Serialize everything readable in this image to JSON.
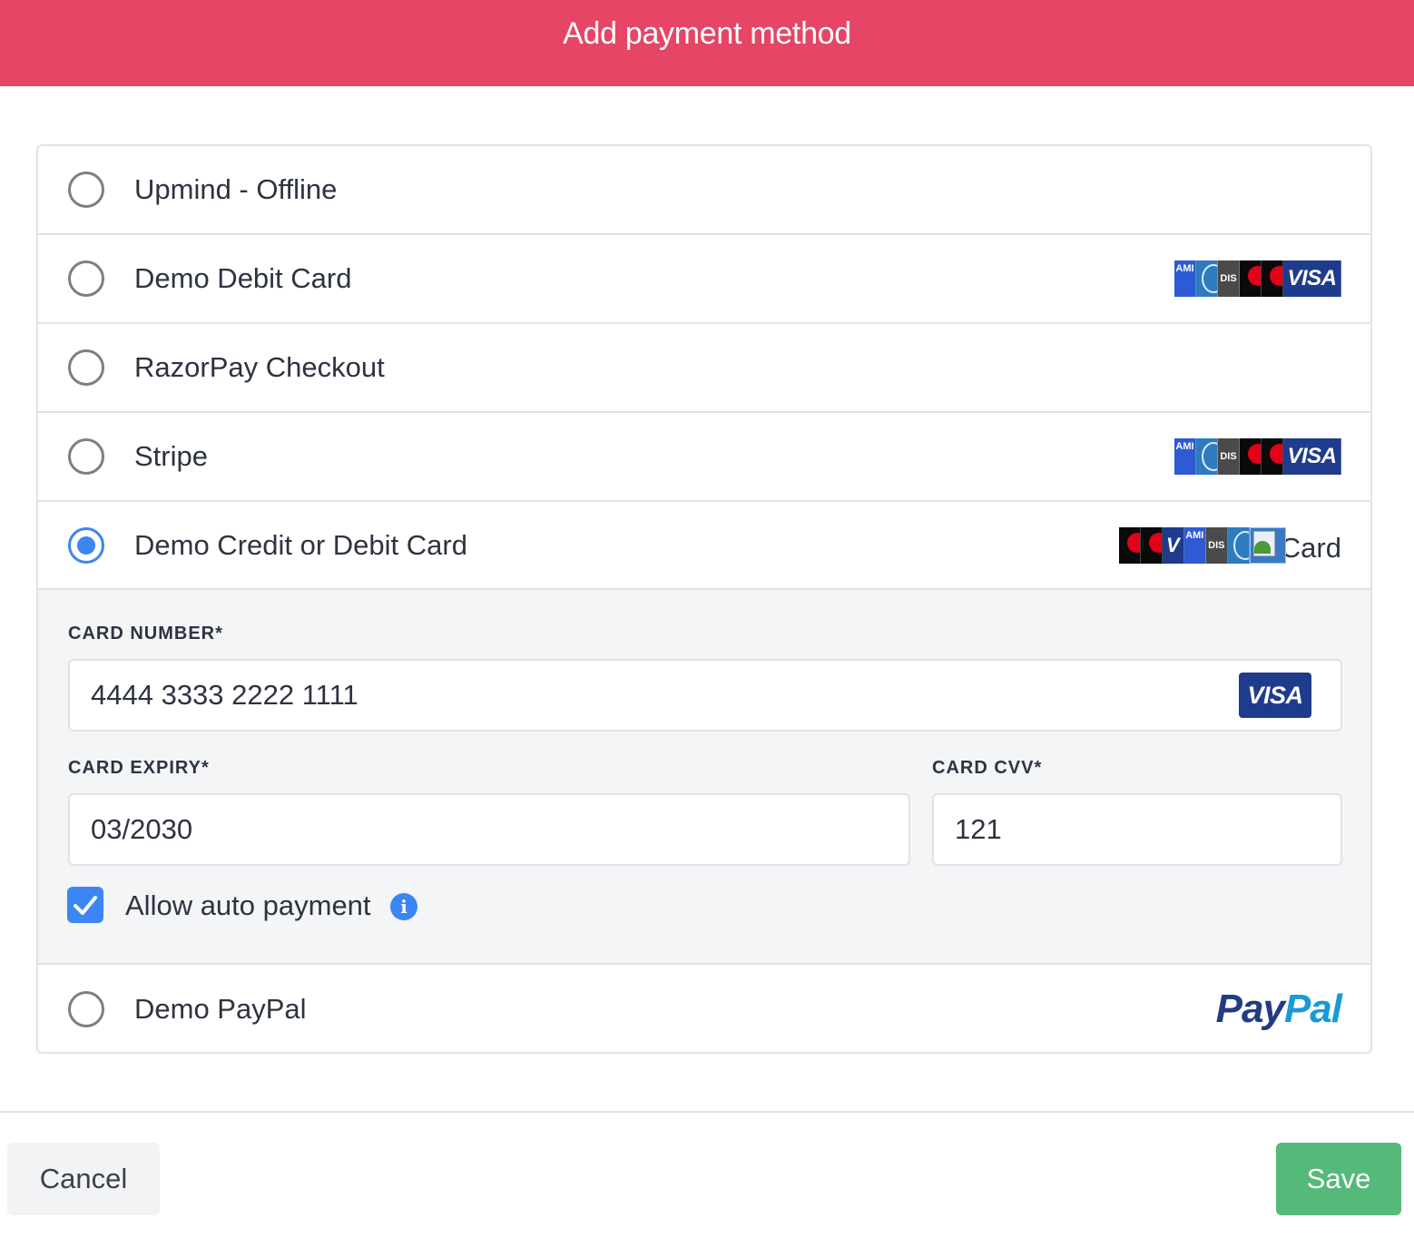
{
  "header": {
    "title": "Add payment method"
  },
  "methods": [
    {
      "label": "Upmind - Offline",
      "selected": false,
      "logos": []
    },
    {
      "label": "Demo Debit Card",
      "selected": false,
      "logos": [
        "amex",
        "diners",
        "discover",
        "mastercard",
        "maestro",
        "visa"
      ]
    },
    {
      "label": "RazorPay Checkout",
      "selected": false,
      "logos": []
    },
    {
      "label": "Stripe",
      "selected": false,
      "logos": [
        "amex",
        "diners",
        "discover",
        "mastercard",
        "maestro",
        "visa"
      ]
    },
    {
      "label": "Demo Credit or Debit Card",
      "selected": true,
      "logos": [
        "mastercard",
        "maestro",
        "visa",
        "amex",
        "discover",
        "diners",
        "broken-image"
      ],
      "logo_alt_text": "Card"
    },
    {
      "label": "Demo PayPal",
      "selected": false,
      "logo_text_pay": "Pay",
      "logo_text_pal": "Pal"
    }
  ],
  "card_form": {
    "card_number_label": "CARD NUMBER*",
    "card_number_value": "4444 3333 2222 1111",
    "card_brand_badge": "VISA",
    "card_expiry_label": "CARD EXPIRY*",
    "card_expiry_value": "03/2030",
    "card_cvv_label": "CARD CVV*",
    "card_cvv_value": "121",
    "auto_payment_label": "Allow auto payment",
    "auto_payment_checked": true,
    "info_icon_glyph": "i"
  },
  "logo_text": {
    "amex": "AMI",
    "discover": "DIS",
    "visa": "VISA",
    "visa_mini": "V"
  },
  "footer": {
    "cancel_label": "Cancel",
    "save_label": "Save"
  },
  "colors": {
    "header": "#e64565",
    "accent": "#3b86f2",
    "save": "#55b97a",
    "visa": "#1f3b8c",
    "paypal_dark": "#253b80",
    "paypal_light": "#179bd7"
  }
}
